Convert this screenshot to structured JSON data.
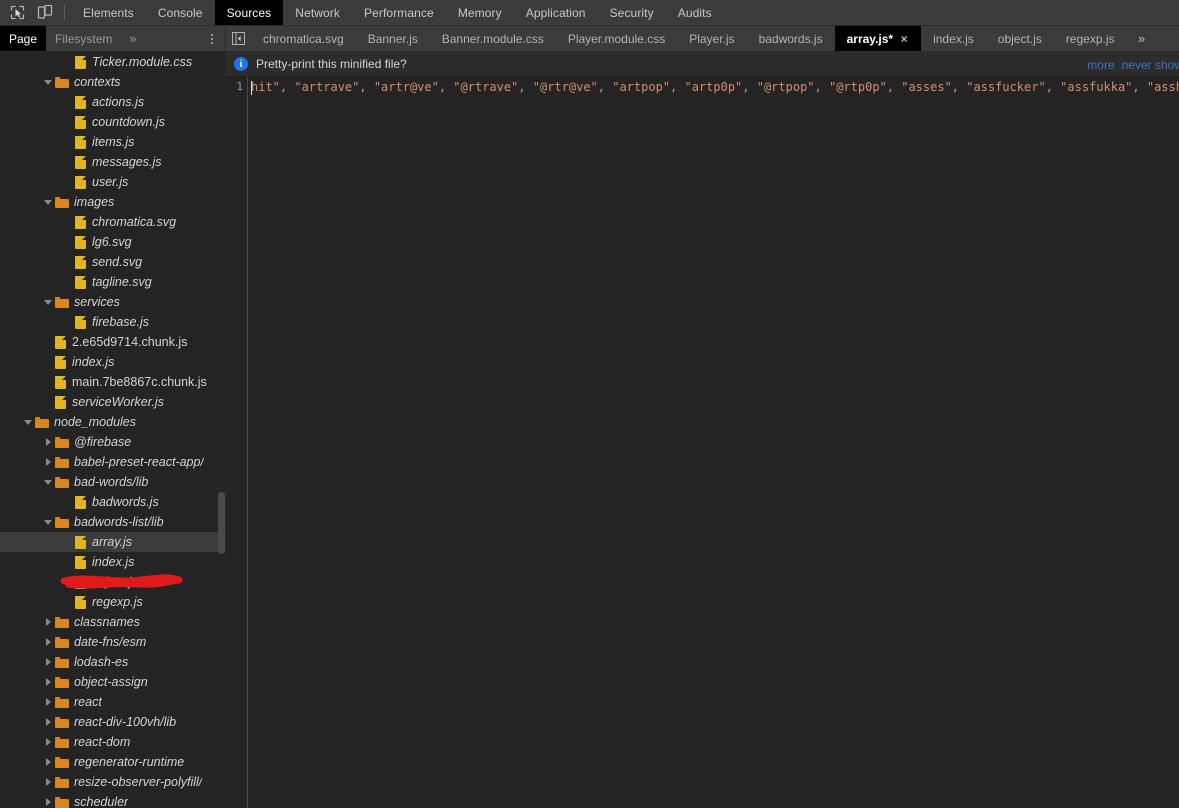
{
  "toolbar": {
    "inspect_icon": "inspect-cursor-icon",
    "device_icon": "device-toolbar-icon",
    "panels": [
      {
        "label": "Elements",
        "selected": false
      },
      {
        "label": "Console",
        "selected": false
      },
      {
        "label": "Sources",
        "selected": true
      },
      {
        "label": "Network",
        "selected": false
      },
      {
        "label": "Performance",
        "selected": false
      },
      {
        "label": "Memory",
        "selected": false
      },
      {
        "label": "Application",
        "selected": false
      },
      {
        "label": "Security",
        "selected": false
      },
      {
        "label": "Audits",
        "selected": false
      }
    ]
  },
  "navigator_header": {
    "tabs": [
      {
        "label": "Page",
        "selected": true
      },
      {
        "label": "Filesystem",
        "selected": false
      }
    ],
    "more_glyph": "»",
    "kebab_label": "more-options"
  },
  "editor_tabs": {
    "collapse_glyph": "◀",
    "overflow_glyph": "»",
    "close_glyph": "×",
    "items": [
      {
        "label": "chromatica.svg",
        "selected": false,
        "closable": false
      },
      {
        "label": "Banner.js",
        "selected": false,
        "closable": false
      },
      {
        "label": "Banner.module.css",
        "selected": false,
        "closable": false
      },
      {
        "label": "Player.module.css",
        "selected": false,
        "closable": false
      },
      {
        "label": "Player.js",
        "selected": false,
        "closable": false
      },
      {
        "label": "badwords.js",
        "selected": false,
        "closable": false
      },
      {
        "label": "array.js*",
        "selected": true,
        "closable": true
      },
      {
        "label": "index.js",
        "selected": false,
        "closable": false
      },
      {
        "label": "object.js",
        "selected": false,
        "closable": false
      },
      {
        "label": "regexp.js",
        "selected": false,
        "closable": false
      }
    ]
  },
  "file_tree": [
    {
      "label": "Ticker.module.css",
      "type": "file",
      "depth": 3,
      "arrow": "none",
      "selected": false,
      "italic": true
    },
    {
      "label": "contexts",
      "type": "folder",
      "depth": 2,
      "arrow": "expanded",
      "selected": false,
      "italic": true
    },
    {
      "label": "actions.js",
      "type": "file",
      "depth": 3,
      "arrow": "none",
      "selected": false,
      "italic": true
    },
    {
      "label": "countdown.js",
      "type": "file",
      "depth": 3,
      "arrow": "none",
      "selected": false,
      "italic": true
    },
    {
      "label": "items.js",
      "type": "file",
      "depth": 3,
      "arrow": "none",
      "selected": false,
      "italic": true
    },
    {
      "label": "messages.js",
      "type": "file",
      "depth": 3,
      "arrow": "none",
      "selected": false,
      "italic": true
    },
    {
      "label": "user.js",
      "type": "file",
      "depth": 3,
      "arrow": "none",
      "selected": false,
      "italic": true
    },
    {
      "label": "images",
      "type": "folder",
      "depth": 2,
      "arrow": "expanded",
      "selected": false,
      "italic": true
    },
    {
      "label": "chromatica.svg",
      "type": "file",
      "depth": 3,
      "arrow": "none",
      "selected": false,
      "italic": true
    },
    {
      "label": "lg6.svg",
      "type": "file",
      "depth": 3,
      "arrow": "none",
      "selected": false,
      "italic": true
    },
    {
      "label": "send.svg",
      "type": "file",
      "depth": 3,
      "arrow": "none",
      "selected": false,
      "italic": true
    },
    {
      "label": "tagline.svg",
      "type": "file",
      "depth": 3,
      "arrow": "none",
      "selected": false,
      "italic": true
    },
    {
      "label": "services",
      "type": "folder",
      "depth": 2,
      "arrow": "expanded",
      "selected": false,
      "italic": true
    },
    {
      "label": "firebase.js",
      "type": "file",
      "depth": 3,
      "arrow": "none",
      "selected": false,
      "italic": true
    },
    {
      "label": "2.e65d9714.chunk.js",
      "type": "file",
      "depth": 2,
      "arrow": "none",
      "selected": false,
      "italic": false
    },
    {
      "label": "index.js",
      "type": "file",
      "depth": 2,
      "arrow": "none",
      "selected": false,
      "italic": true
    },
    {
      "label": "main.7be8867c.chunk.js",
      "type": "file",
      "depth": 2,
      "arrow": "none",
      "selected": false,
      "italic": false
    },
    {
      "label": "serviceWorker.js",
      "type": "file",
      "depth": 2,
      "arrow": "none",
      "selected": false,
      "italic": true
    },
    {
      "label": "node_modules",
      "type": "folder",
      "depth": 1,
      "arrow": "expanded",
      "selected": false,
      "italic": true
    },
    {
      "label": "@firebase",
      "type": "folder",
      "depth": 2,
      "arrow": "collapsed",
      "selected": false,
      "italic": true
    },
    {
      "label": "babel-preset-react-app/",
      "type": "folder",
      "depth": 2,
      "arrow": "collapsed",
      "selected": false,
      "italic": true
    },
    {
      "label": "bad-words/lib",
      "type": "folder",
      "depth": 2,
      "arrow": "expanded",
      "selected": false,
      "italic": true
    },
    {
      "label": "badwords.js",
      "type": "file",
      "depth": 3,
      "arrow": "none",
      "selected": false,
      "italic": true
    },
    {
      "label": "badwords-list/lib",
      "type": "folder",
      "depth": 2,
      "arrow": "expanded",
      "selected": false,
      "italic": true
    },
    {
      "label": "array.js",
      "type": "file",
      "depth": 3,
      "arrow": "none",
      "selected": true,
      "italic": true
    },
    {
      "label": "index.js",
      "type": "file",
      "depth": 3,
      "arrow": "none",
      "selected": false,
      "italic": true
    },
    {
      "label": "object.js",
      "type": "file",
      "depth": 3,
      "arrow": "none",
      "selected": false,
      "italic": true
    },
    {
      "label": "regexp.js",
      "type": "file",
      "depth": 3,
      "arrow": "none",
      "selected": false,
      "italic": true
    },
    {
      "label": "classnames",
      "type": "folder",
      "depth": 2,
      "arrow": "collapsed",
      "selected": false,
      "italic": true
    },
    {
      "label": "date-fns/esm",
      "type": "folder",
      "depth": 2,
      "arrow": "collapsed",
      "selected": false,
      "italic": true
    },
    {
      "label": "lodash-es",
      "type": "folder",
      "depth": 2,
      "arrow": "collapsed",
      "selected": false,
      "italic": true
    },
    {
      "label": "object-assign",
      "type": "folder",
      "depth": 2,
      "arrow": "collapsed",
      "selected": false,
      "italic": true
    },
    {
      "label": "react",
      "type": "folder",
      "depth": 2,
      "arrow": "collapsed",
      "selected": false,
      "italic": true
    },
    {
      "label": "react-div-100vh/lib",
      "type": "folder",
      "depth": 2,
      "arrow": "collapsed",
      "selected": false,
      "italic": true
    },
    {
      "label": "react-dom",
      "type": "folder",
      "depth": 2,
      "arrow": "collapsed",
      "selected": false,
      "italic": true
    },
    {
      "label": "regenerator-runtime",
      "type": "folder",
      "depth": 2,
      "arrow": "collapsed",
      "selected": false,
      "italic": true
    },
    {
      "label": "resize-observer-polyfill/",
      "type": "folder",
      "depth": 2,
      "arrow": "collapsed",
      "selected": false,
      "italic": true
    },
    {
      "label": "scheduler",
      "type": "folder",
      "depth": 2,
      "arrow": "collapsed",
      "selected": false,
      "italic": true
    }
  ],
  "infobar": {
    "icon": "info-icon",
    "icon_glyph": "i",
    "message": "Pretty-print this minified file?",
    "link_more": "more",
    "link_never_show": "never show"
  },
  "editor": {
    "line_number": "1",
    "code": "hit\", \"artrave\", \"artr@ve\", \"@rtrave\", \"@rtr@ve\", \"artpop\", \"artp0p\", \"@rtpop\", \"@rtp0p\", \"asses\", \"assfucker\", \"assfukka\", \"asshole\", \"assh"
  },
  "annotation": {
    "type": "red-scribble",
    "color": "#e01b1b",
    "target": "array.js"
  },
  "colors": {
    "background": "#242424",
    "toolbar": "#3b3b3b",
    "selected_tab": "#000000",
    "selected_row": "#3b3b3b",
    "folder_icon": "#d9861f",
    "file_icon": "#e0b521",
    "string_literal": "#d68d6b",
    "link": "#3a75c4",
    "info_badge": "#1a73e8"
  }
}
